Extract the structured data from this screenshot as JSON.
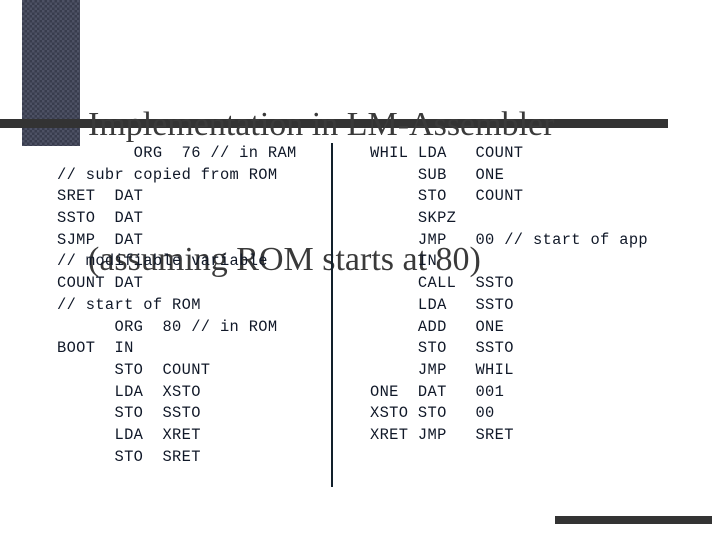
{
  "slide": {
    "title_lines": [
      "Implementation in LM-Assembler",
      "(assuming ROM starts at 80)"
    ],
    "title_color": "#3a3a3a",
    "background_color": "#ffffff",
    "accent_color": "#333333",
    "texture_color": "#4d5164",
    "code_color": "#101828",
    "divider_color": "#12202b"
  },
  "code": {
    "left_column": [
      "        ORG  76 // in RAM",
      "// subr copied from ROM",
      "SRET  DAT",
      "SSTO  DAT",
      "SJMP  DAT",
      "// modifiable variable",
      "COUNT DAT",
      "// start of ROM",
      "      ORG  80 // in ROM",
      "BOOT  IN",
      "      STO  COUNT",
      "      LDA  XSTO",
      "      STO  SSTO",
      "      LDA  XRET",
      "      STO  SRET"
    ],
    "right_column": [
      "WHIL LDA   COUNT",
      "     SUB   ONE",
      "     STO   COUNT",
      "     SKPZ",
      "     JMP   00 // start of app",
      "     IN",
      "     CALL  SSTO",
      "     LDA   SSTO",
      "     ADD   ONE",
      "     STO   SSTO",
      "     JMP   WHIL",
      "ONE  DAT   001",
      "XSTO STO   00",
      "XRET JMP   SRET"
    ]
  }
}
